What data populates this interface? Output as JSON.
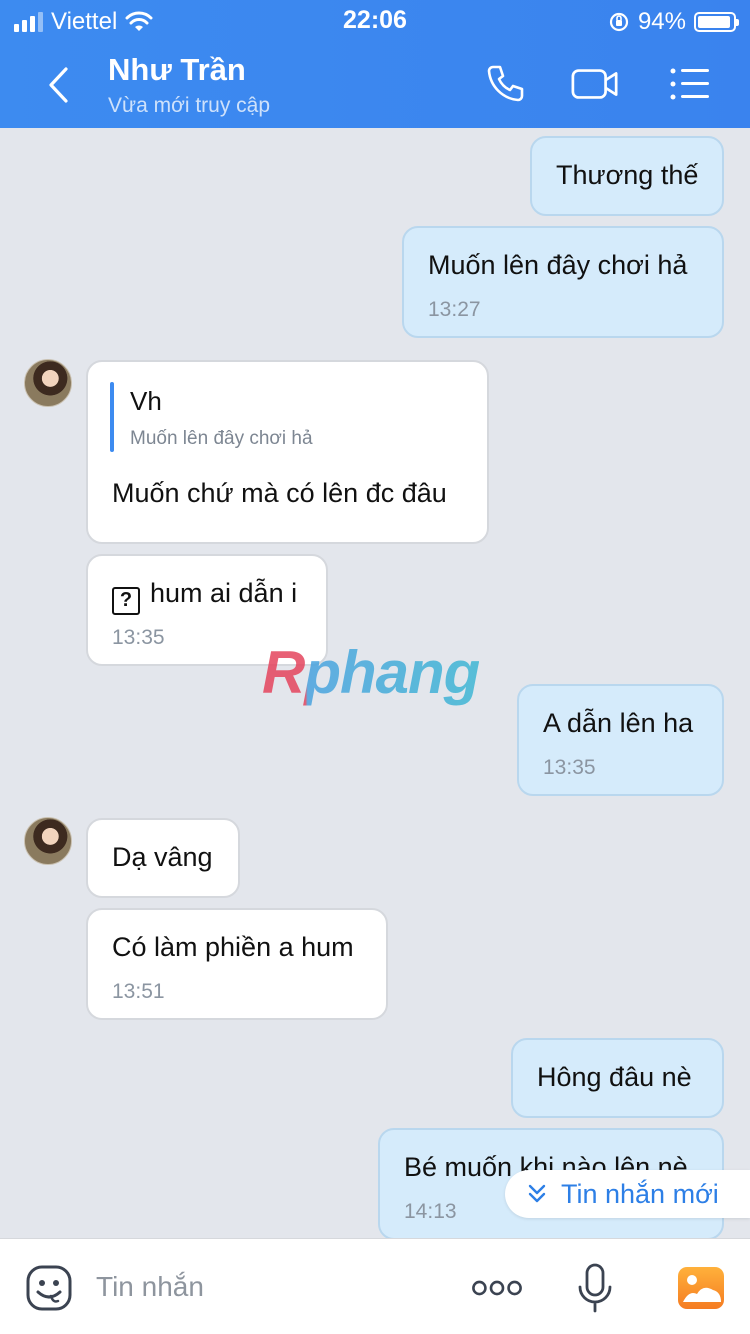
{
  "status_bar": {
    "carrier": "Viettel",
    "time": "22:06",
    "battery": "94%",
    "battery_level": 0.94
  },
  "header": {
    "name": "Như Trần",
    "status": "Vừa mới truy cập"
  },
  "messages": [
    {
      "dir": "out",
      "text": "Thương thế"
    },
    {
      "dir": "out",
      "text": "Muốn lên đây chơi hả",
      "time": "13:27"
    },
    {
      "dir": "in",
      "quote_name": "Vh",
      "quote_text": "Muốn lên đây chơi hả",
      "text": "Muốn chứ mà có lên đc đâu"
    },
    {
      "dir": "in",
      "text": "hum ai dẫn i",
      "time": "13:35"
    },
    {
      "dir": "out",
      "text": "A dẫn lên ha",
      "time": "13:35"
    },
    {
      "dir": "in",
      "text": "Dạ vâng"
    },
    {
      "dir": "in",
      "text": "Có làm phiền a hum",
      "time": "13:51"
    },
    {
      "dir": "out",
      "text": "Hông đâu nè"
    },
    {
      "dir": "out",
      "text": "Bé muốn khi nào lên nè",
      "time": "14:13"
    }
  ],
  "watermark": "Rphang",
  "new_messages_label": "Tin nhắn mới",
  "input": {
    "placeholder": "Tin nhắn"
  },
  "colors": {
    "header": "#3d8bf0",
    "outgoing_bubble": "#d5ebfb",
    "incoming_bubble": "#ffffff",
    "background": "#e3e6ec",
    "accent": "#2d7fe6"
  },
  "icons": [
    "back-icon",
    "phone-icon",
    "video-icon",
    "menu-icon",
    "emoji-icon",
    "more-icon",
    "mic-icon",
    "image-icon"
  ]
}
